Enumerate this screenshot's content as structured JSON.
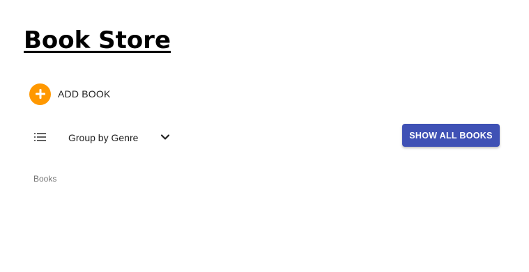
{
  "header": {
    "title": "Book Store"
  },
  "actions": {
    "add_book_label": "ADD BOOK",
    "add_icon": "plus-circle-icon",
    "show_all_label": "SHOW ALL BOOKS"
  },
  "grouping": {
    "list_icon": "list-icon",
    "selected": "Group by Genre",
    "dropdown_icon": "chevron-down-icon"
  },
  "section": {
    "books_label": "Books"
  },
  "colors": {
    "accent_orange": "#ff9800",
    "primary_blue": "#3f51b5"
  }
}
